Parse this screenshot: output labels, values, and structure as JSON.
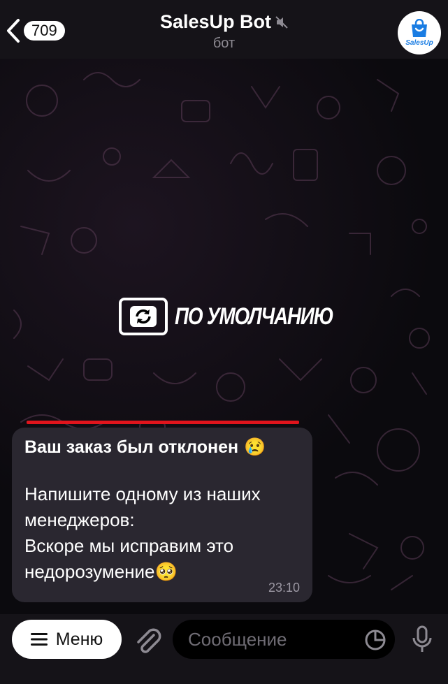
{
  "header": {
    "back_count": "709",
    "title": "SalesUp Bot",
    "subtitle": "бот",
    "avatar_text": "SalesUp"
  },
  "watermark": {
    "text": "ПО УМОЛЧАНИЮ"
  },
  "message": {
    "title": "Ваш заказ был отклонен",
    "title_emoji": "😢",
    "lines": [
      "Напишите одному из наших",
      "менеджеров:",
      "Вскоре мы исправим это",
      "недорозумение"
    ],
    "end_emoji": "🥺",
    "time": "23:10"
  },
  "bottom": {
    "menu_label": "Меню",
    "input_placeholder": "Сообщение"
  },
  "icons": {
    "back": "chevron-left-icon",
    "mute": "muted-speaker-icon",
    "attach": "paperclip-icon",
    "sticker": "sticker-icon",
    "mic": "microphone-icon",
    "menu": "hamburger-icon"
  },
  "colors": {
    "accent_line": "#e0141c",
    "bubble": "#2a2730",
    "avatar_brand": "#1a7de3"
  }
}
